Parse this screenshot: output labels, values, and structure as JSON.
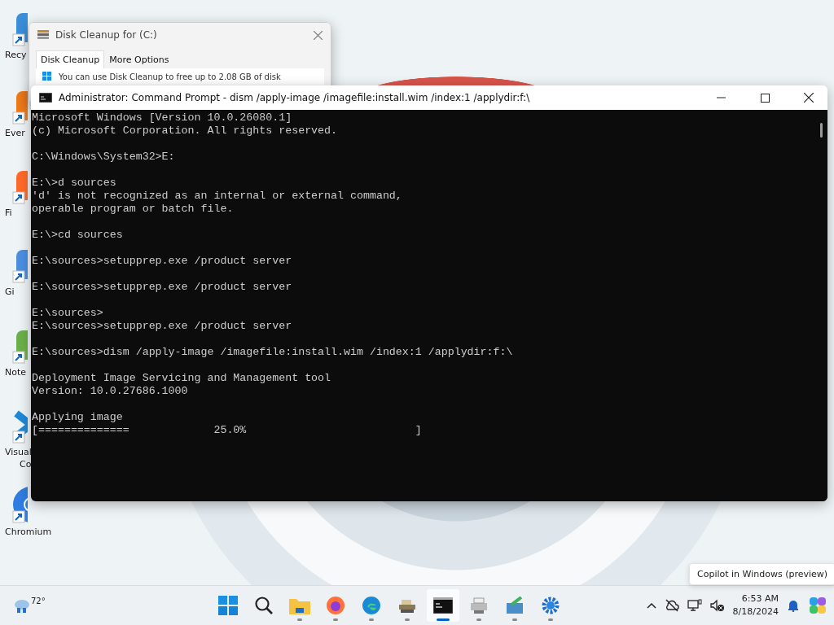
{
  "desktop_icons": [
    {
      "label": "Recy",
      "kind": "recycle"
    },
    {
      "label": "Ever",
      "kind": "orange"
    },
    {
      "label": "Fi",
      "kind": "firefox"
    },
    {
      "label": "Gi",
      "kind": "git"
    },
    {
      "label": "Note",
      "kind": "notepad"
    },
    {
      "label": "Visual",
      "label_2": "Co",
      "kind": "vscode"
    },
    {
      "label": "Chromium",
      "kind": "chromium"
    }
  ],
  "disk_cleanup": {
    "title": "Disk Cleanup for  (C:)",
    "tabs": [
      {
        "label": "Disk Cleanup",
        "selected": true
      },
      {
        "label": "More Options",
        "selected": false
      }
    ],
    "message": "You can use Disk Cleanup to free up to 2.08 GB of disk"
  },
  "console": {
    "title": "Administrator: Command Prompt - dism  /apply-image /imagefile:install.wim /index:1 /applydir:f:\\",
    "blocks": [
      [
        "Microsoft Windows [Version 10.0.26080.1]",
        "(c) Microsoft Corporation. All rights reserved."
      ],
      [
        "C:\\Windows\\System32>E:"
      ],
      [
        "E:\\>d sources",
        "'d' is not recognized as an internal or external command,",
        "operable program or batch file."
      ],
      [
        "E:\\>cd sources"
      ],
      [
        "E:\\sources>setupprep.exe /product server"
      ],
      [
        "E:\\sources>setupprep.exe /product server"
      ],
      [
        "E:\\sources>",
        "E:\\sources>setupprep.exe /product server"
      ],
      [
        "E:\\sources>dism /apply-image /imagefile:install.wim /index:1 /applydir:f:\\"
      ],
      [
        "Deployment Image Servicing and Management tool",
        "Version: 10.0.27686.1000"
      ],
      [
        "Applying image",
        "[==============             25.0%                          ]"
      ]
    ]
  },
  "taskbar": {
    "weather": "72°",
    "apps": [
      {
        "kind": "start",
        "running": false,
        "selected": false
      },
      {
        "kind": "search",
        "running": false,
        "selected": false
      },
      {
        "kind": "explorer",
        "running": true,
        "selected": false
      },
      {
        "kind": "firefox",
        "running": true,
        "selected": false
      },
      {
        "kind": "edge",
        "running": true,
        "selected": false
      },
      {
        "kind": "tool",
        "running": true,
        "selected": false
      },
      {
        "kind": "terminal",
        "running": true,
        "selected": true
      },
      {
        "kind": "printer",
        "running": true,
        "selected": false
      },
      {
        "kind": "installer",
        "running": true,
        "selected": false
      },
      {
        "kind": "gear",
        "running": true,
        "selected": false
      }
    ],
    "time": "6:53 AM",
    "date": "8/18/2024",
    "tooltip": "Copilot in Windows (preview)"
  }
}
